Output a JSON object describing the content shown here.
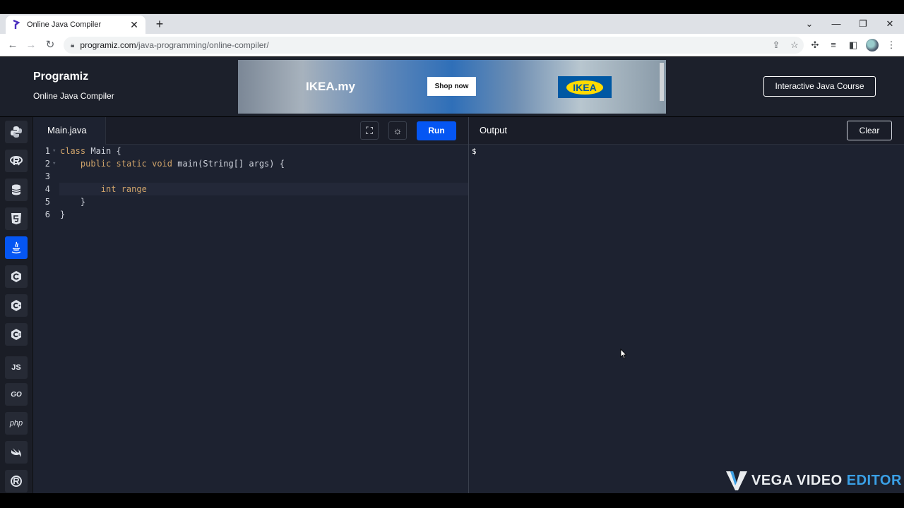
{
  "browser": {
    "tab_title": "Online Java Compiler",
    "url_host": "programiz.com",
    "url_path": "/java-programming/online-compiler/"
  },
  "header": {
    "logo": "Programiz",
    "subtitle": "Online Java Compiler",
    "course_button": "Interactive Java Course",
    "ad": {
      "brand": "IKEA.my",
      "cta": "Shop now",
      "logo": "IKEA"
    }
  },
  "languages": [
    {
      "name": "python",
      "label": ""
    },
    {
      "name": "r",
      "label": ""
    },
    {
      "name": "sql",
      "label": ""
    },
    {
      "name": "html",
      "label": ""
    },
    {
      "name": "java",
      "label": ""
    },
    {
      "name": "c",
      "label": ""
    },
    {
      "name": "cpp",
      "label": ""
    },
    {
      "name": "csharp",
      "label": ""
    },
    {
      "name": "javascript",
      "label": "JS"
    },
    {
      "name": "go",
      "label": "GO"
    },
    {
      "name": "php",
      "label": "php"
    },
    {
      "name": "swift",
      "label": ""
    },
    {
      "name": "rust",
      "label": ""
    }
  ],
  "editor": {
    "file_tab": "Main.java",
    "run_label": "Run",
    "lines": [
      {
        "num": "1",
        "text": "class Main {"
      },
      {
        "num": "2",
        "text": "    public static void main(String[] args) {"
      },
      {
        "num": "3",
        "text": ""
      },
      {
        "num": "4",
        "text": "        int range"
      },
      {
        "num": "5",
        "text": "    }"
      },
      {
        "num": "6",
        "text": "}"
      }
    ]
  },
  "output": {
    "title": "Output",
    "clear_label": "Clear",
    "prompt": "$"
  },
  "watermark": {
    "part1": "VEGA VIDEO",
    "part2": "EDITOR"
  }
}
